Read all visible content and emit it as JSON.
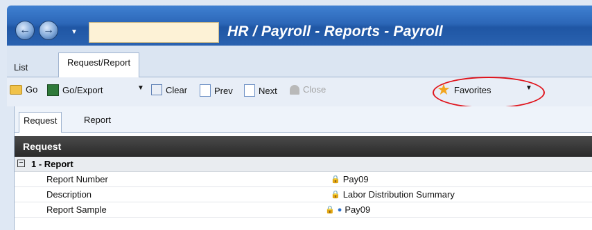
{
  "window": {
    "title": "HR / Payroll - Reports - Payroll",
    "address_value": ""
  },
  "top_tabs": [
    {
      "label": "List",
      "active": false
    },
    {
      "label": "Request/Report",
      "active": true
    }
  ],
  "toolbar": {
    "go": "Go",
    "go_export": "Go/Export",
    "clear": "Clear",
    "prev": "Prev",
    "next": "Next",
    "close": "Close",
    "favorites": "Favorites"
  },
  "sub_tabs": [
    {
      "label": "Request",
      "active": true
    },
    {
      "label": "Report",
      "active": false
    }
  ],
  "grid": {
    "header": "Request",
    "category": {
      "toggle": "−",
      "label": "1 - Report"
    },
    "rows": [
      {
        "name": "Report Number",
        "value": "Pay09"
      },
      {
        "name": "Description",
        "value": "Labor Distribution Summary"
      },
      {
        "name": "Report Sample",
        "value": "Pay09"
      }
    ]
  },
  "colors": {
    "title_bar": "#2c67b8",
    "annotation": "#e0131b",
    "grid_header": "#2a2a2a"
  }
}
